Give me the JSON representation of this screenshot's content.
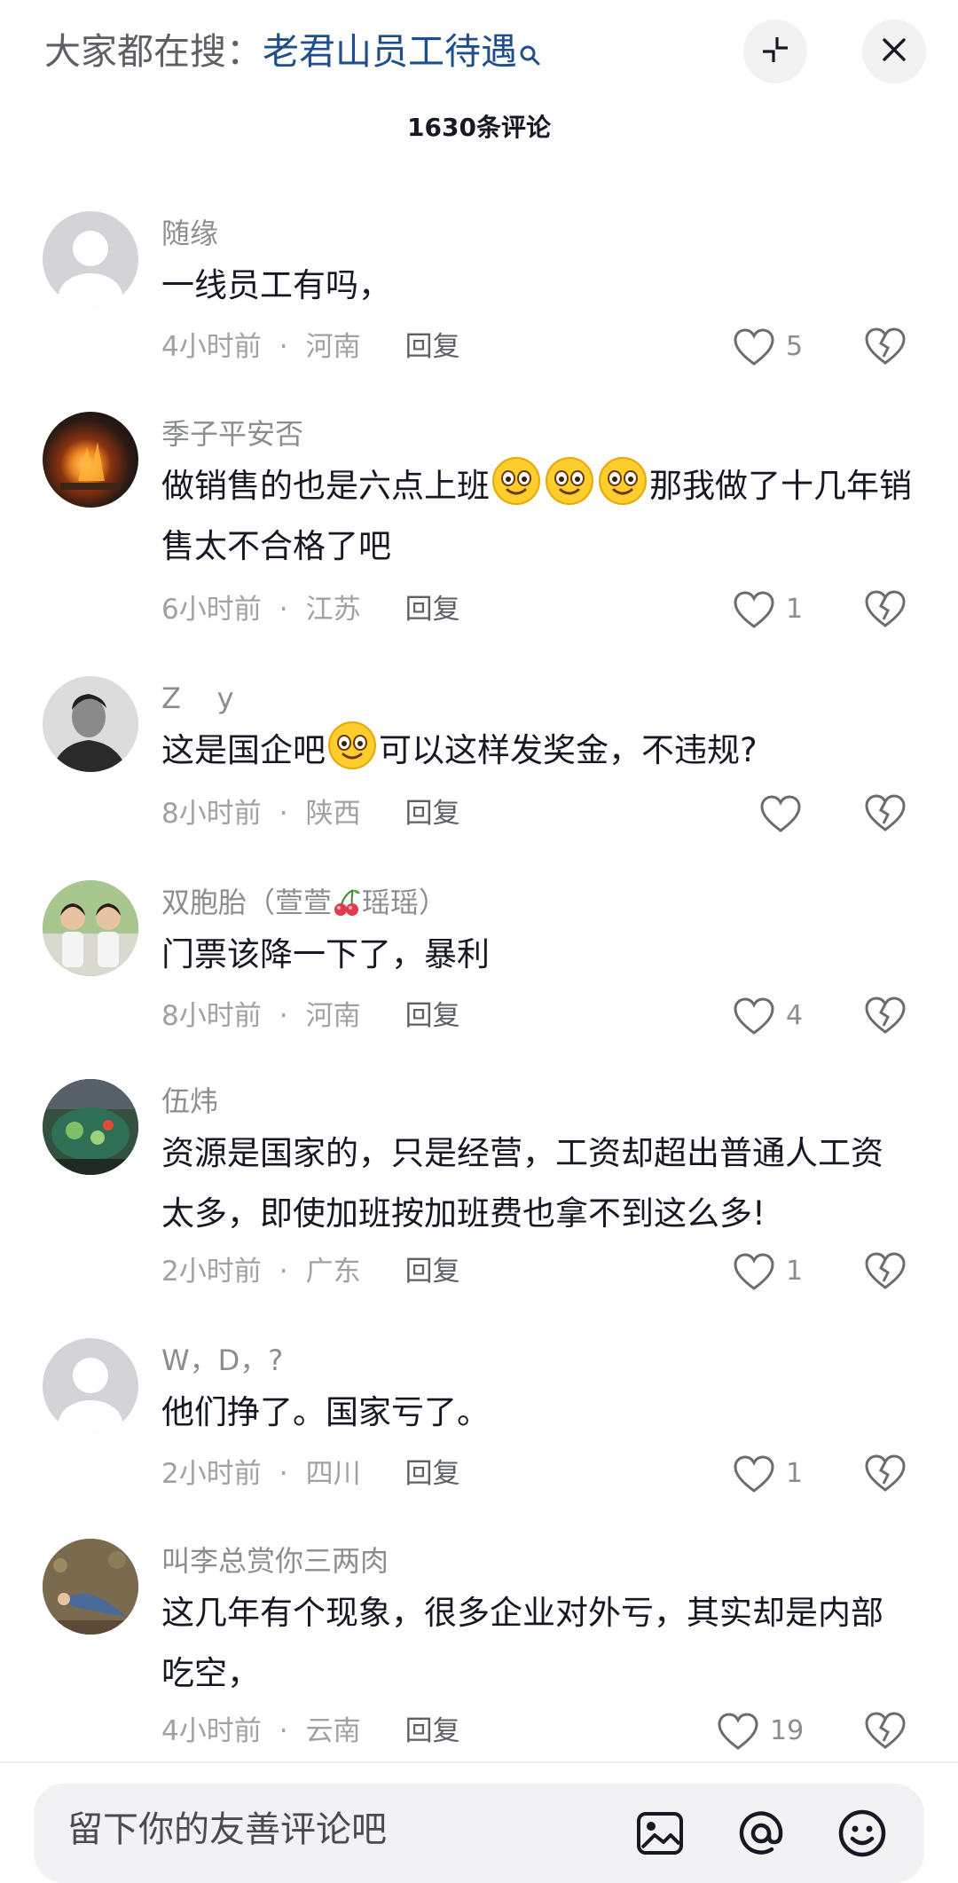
{
  "header": {
    "search_prefix": "大家都在搜：",
    "search_term": "老君山员工待遇",
    "comment_count": "1630条评论"
  },
  "comments": [
    {
      "username": "随缘",
      "text": "一线员工有吗，",
      "time": "4小时前",
      "region": "河南",
      "reply_label": "回复",
      "likes": "5"
    },
    {
      "username": "季子平安否",
      "text_parts": [
        "做销售的也是六点上班",
        "那我做了十几年销售太不合格了吧"
      ],
      "time": "6小时前",
      "region": "江苏",
      "reply_label": "回复",
      "likes": "1"
    },
    {
      "username": "Z    y",
      "text_parts": [
        "这是国企吧",
        "可以这样发奖金，不违规?"
      ],
      "time": "8小时前",
      "region": "陕西",
      "reply_label": "回复",
      "likes": ""
    },
    {
      "username_parts": [
        "双胞胎（萱萱",
        "瑶瑶）"
      ],
      "text": "门票该降一下了，暴利",
      "time": "8小时前",
      "region": "河南",
      "reply_label": "回复",
      "likes": "4"
    },
    {
      "username": "伍炜",
      "text": "资源是国家的，只是经营，工资却超出普通人工资太多，即使加班按加班费也拿不到这么多!",
      "time": "2小时前",
      "region": "广东",
      "reply_label": "回复",
      "likes": "1"
    },
    {
      "username": "W，D，?",
      "text": "他们挣了。国家亏了。",
      "time": "2小时前",
      "region": "四川",
      "reply_label": "回复",
      "likes": "1"
    },
    {
      "username": "叫李总赏你三两肉",
      "text": "这几年有个现象，很多企业对外亏，其实却是内部吃空，",
      "time": "4小时前",
      "region": "云南",
      "reply_label": "回复",
      "likes": "19"
    }
  ],
  "meta_separator": "·",
  "input": {
    "placeholder": "留下你的友善评论吧"
  },
  "icons": {
    "search": "search-icon",
    "collapse": "collapse-icon",
    "close": "close-icon",
    "like": "heart-icon",
    "dislike": "broken-heart-icon",
    "image": "image-icon",
    "mention": "at-icon",
    "emoji": "emoji-icon"
  }
}
